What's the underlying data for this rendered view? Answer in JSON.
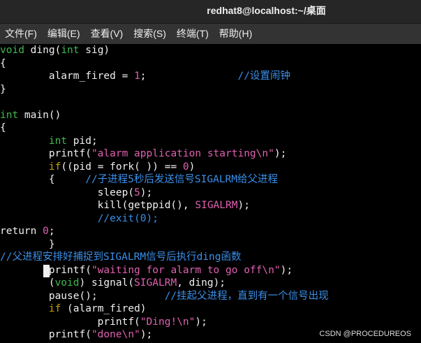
{
  "window": {
    "title": "redhat8@localhost:~/桌面"
  },
  "menubar": {
    "file": "文件(F)",
    "edit": "编辑(E)",
    "view": "查看(V)",
    "search": "搜索(S)",
    "terminal": "终端(T)",
    "help": "帮助(H)"
  },
  "code": {
    "l01": [
      "void",
      " ding(",
      "int",
      " sig)"
    ],
    "l02": [
      "{"
    ],
    "l03": [
      "        alarm_fired = ",
      "1",
      ";",
      "               //设置闹钟"
    ],
    "l04": [
      "}"
    ],
    "l05": [
      ""
    ],
    "l06": [
      "int",
      " main()"
    ],
    "l07": [
      "{"
    ],
    "l08": [
      "        ",
      "int",
      " pid;"
    ],
    "l09": [
      "        printf(",
      "\"alarm application starting",
      "\\n",
      "\"",
      ");"
    ],
    "l10": [
      "        ",
      "if",
      "((pid = fork( )) == ",
      "0",
      ")"
    ],
    "l11": [
      "        {     ",
      "//子进程5秒后发送信号SIGALRM给父进程"
    ],
    "l12": [
      "                sleep(",
      "5",
      ");"
    ],
    "l13": [
      "                kill(getppid(), ",
      "SIGALRM",
      ");"
    ],
    "l14": [
      "                ",
      "//exit(0);"
    ],
    "l15": [
      "return ",
      "0",
      ";"
    ],
    "l16": [
      "        }"
    ],
    "l17": [
      "//父进程安排好捕捉到SIGALRM信号后执行ding函数"
    ],
    "l18": [
      "        printf(",
      "\"waiting for alarm to go off",
      "\\n",
      "\"",
      ");"
    ],
    "l19": [
      "        (",
      "void",
      ") signal(",
      "SIGALRM",
      ", ding);"
    ],
    "l20": [
      "        pause();           ",
      "//挂起父进程，直到有一个信号出现"
    ],
    "l21": [
      "        ",
      "if",
      " (alarm_fired)"
    ],
    "l22": [
      "                printf(",
      "\"Ding!",
      "\\n",
      "\"",
      ");"
    ],
    "l23": [
      "        printf(",
      "\"done",
      "\\n",
      "\"",
      ");"
    ]
  },
  "watermark": "CSDN @PROCEDUREOS",
  "colors": {
    "background": "#000000",
    "keyword": "#c4a000",
    "type": "#3fb950",
    "string": "#e060b0",
    "comment": "#3a8fe8"
  }
}
